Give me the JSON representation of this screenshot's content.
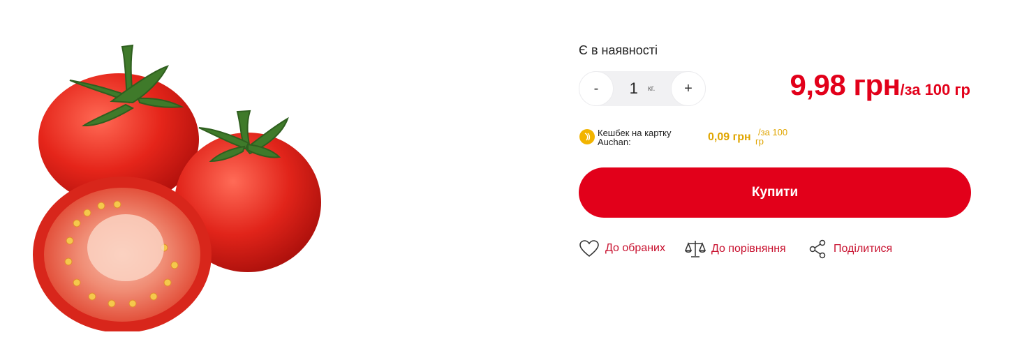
{
  "product": {
    "availability": "Є в наявності",
    "image_icon": "tomatoes-photo"
  },
  "quantity": {
    "decrement_label": "-",
    "increment_label": "+",
    "value": "1",
    "unit": "кг."
  },
  "price": {
    "amount": "9,98 грн",
    "per_unit": "/за 100 гр"
  },
  "cashback": {
    "icon": "cashback-coin-icon",
    "label": "Кешбек на картку Auchan:",
    "value": "0,09 грн",
    "per_top": "/за 100",
    "per_bottom": "гр"
  },
  "buy": {
    "label": "Купити"
  },
  "actions": {
    "favorites": "До обраних",
    "compare": "До порівняння",
    "share": "Поділитися"
  },
  "colors": {
    "accent": "#e2001a",
    "cashback": "#e0a500",
    "link": "#c8102e"
  }
}
